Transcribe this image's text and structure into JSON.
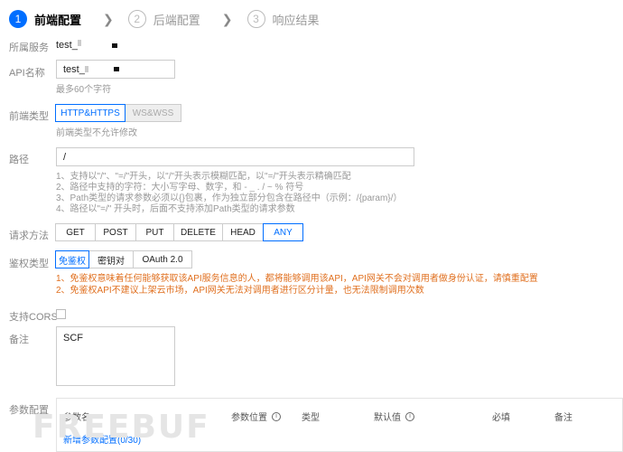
{
  "steps": [
    {
      "num": "1",
      "label": "前端配置"
    },
    {
      "num": "2",
      "label": "后端配置"
    },
    {
      "num": "3",
      "label": "响应结果"
    }
  ],
  "service": {
    "label": "所属服务",
    "value": "test_"
  },
  "api_name": {
    "label": "API名称",
    "value": "test_",
    "hint": "最多60个字符"
  },
  "frontend_type": {
    "label": "前端类型",
    "options": [
      "HTTP&HTTPS",
      "WS&WSS"
    ],
    "selected": "HTTP&HTTPS",
    "hint": "前端类型不允许修改"
  },
  "path": {
    "label": "路径",
    "value": "/",
    "hints": [
      "1、支持以\"/\"、\"=/\"开头，以\"/\"开头表示模糊匹配，以\"=/\"开头表示精确匹配",
      "2、路径中支持的字符：大小写字母、数字，和 - _ . / ~ % 符号",
      "3、Path类型的请求参数必须以{}包裹，作为独立部分包含在路径中（示例：/{param}/）",
      "4、路径以\"=/\" 开头时，后面不支持添加Path类型的请求参数"
    ]
  },
  "method": {
    "label": "请求方法",
    "options": [
      "GET",
      "POST",
      "PUT",
      "DELETE",
      "HEAD",
      "ANY"
    ],
    "selected": "ANY"
  },
  "auth": {
    "label": "鉴权类型",
    "options": [
      "免鉴权",
      "密钥对",
      "OAuth 2.0"
    ],
    "selected": "免鉴权",
    "warnings": [
      "1、免鉴权意味着任何能够获取该API服务信息的人，都将能够调用该API，API网关不会对调用者做身份认证，请慎重配置",
      "2、免鉴权API不建议上架云市场，API网关无法对调用者进行区分计量，也无法限制调用次数"
    ]
  },
  "cors": {
    "label": "支持CORS",
    "checked": false
  },
  "remark": {
    "label": "备注",
    "value": "SCF"
  },
  "params": {
    "label": "参数配置",
    "headers": [
      "参数名",
      "参数位置",
      "类型",
      "默认值",
      "必填",
      "备注"
    ],
    "info_glyph": "i",
    "add_link": "新增参数配置(0/30)"
  },
  "watermark": "FREEBUF"
}
